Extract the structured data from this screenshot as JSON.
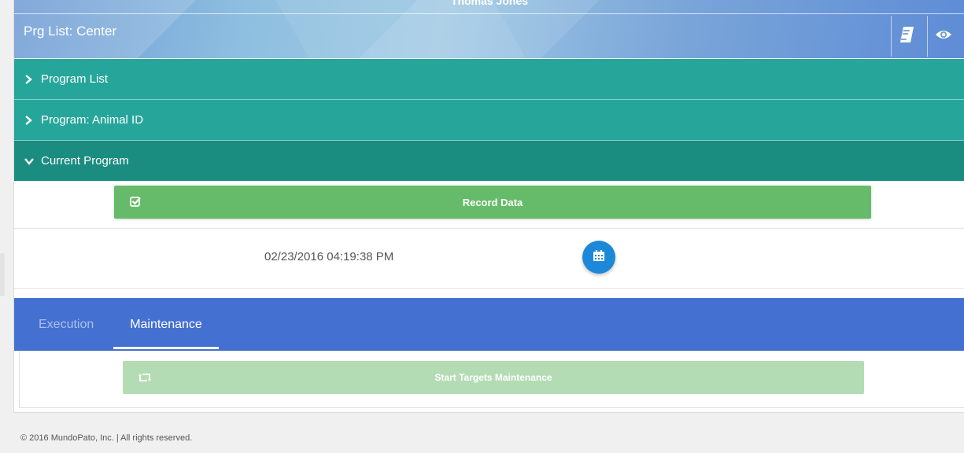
{
  "header": {
    "user_name": "Thomas Jones",
    "page_title": "Prg List: Center",
    "icons": [
      "book-icon",
      "eye-icon"
    ]
  },
  "accordion": [
    {
      "label": "Program List",
      "expanded": false
    },
    {
      "label": "Program: Animal ID",
      "expanded": false
    },
    {
      "label": "Current Program",
      "expanded": true
    }
  ],
  "current_program": {
    "record_button_label": "Record Data",
    "datetime": "02/23/2016 04:19:38 PM",
    "icons": [
      "check-square-icon",
      "calendar-icon"
    ]
  },
  "tabs": {
    "items": [
      "Execution",
      "Maintenance"
    ],
    "active": "Maintenance"
  },
  "maintenance": {
    "button_label": "Start Targets Maintenance",
    "disabled": true,
    "icons": [
      "retweet-icon"
    ]
  },
  "footer": {
    "copyright": "© 2016 MundoPato, Inc. | All rights reserved."
  },
  "colors": {
    "accordion": "#26a69a",
    "accordion_open": "#1b8c80",
    "record_button": "#66bb6a",
    "calendar_button": "#1e88d8",
    "tabs_bar": "#4470d2",
    "maintenance_button": "#b3dcb5"
  }
}
